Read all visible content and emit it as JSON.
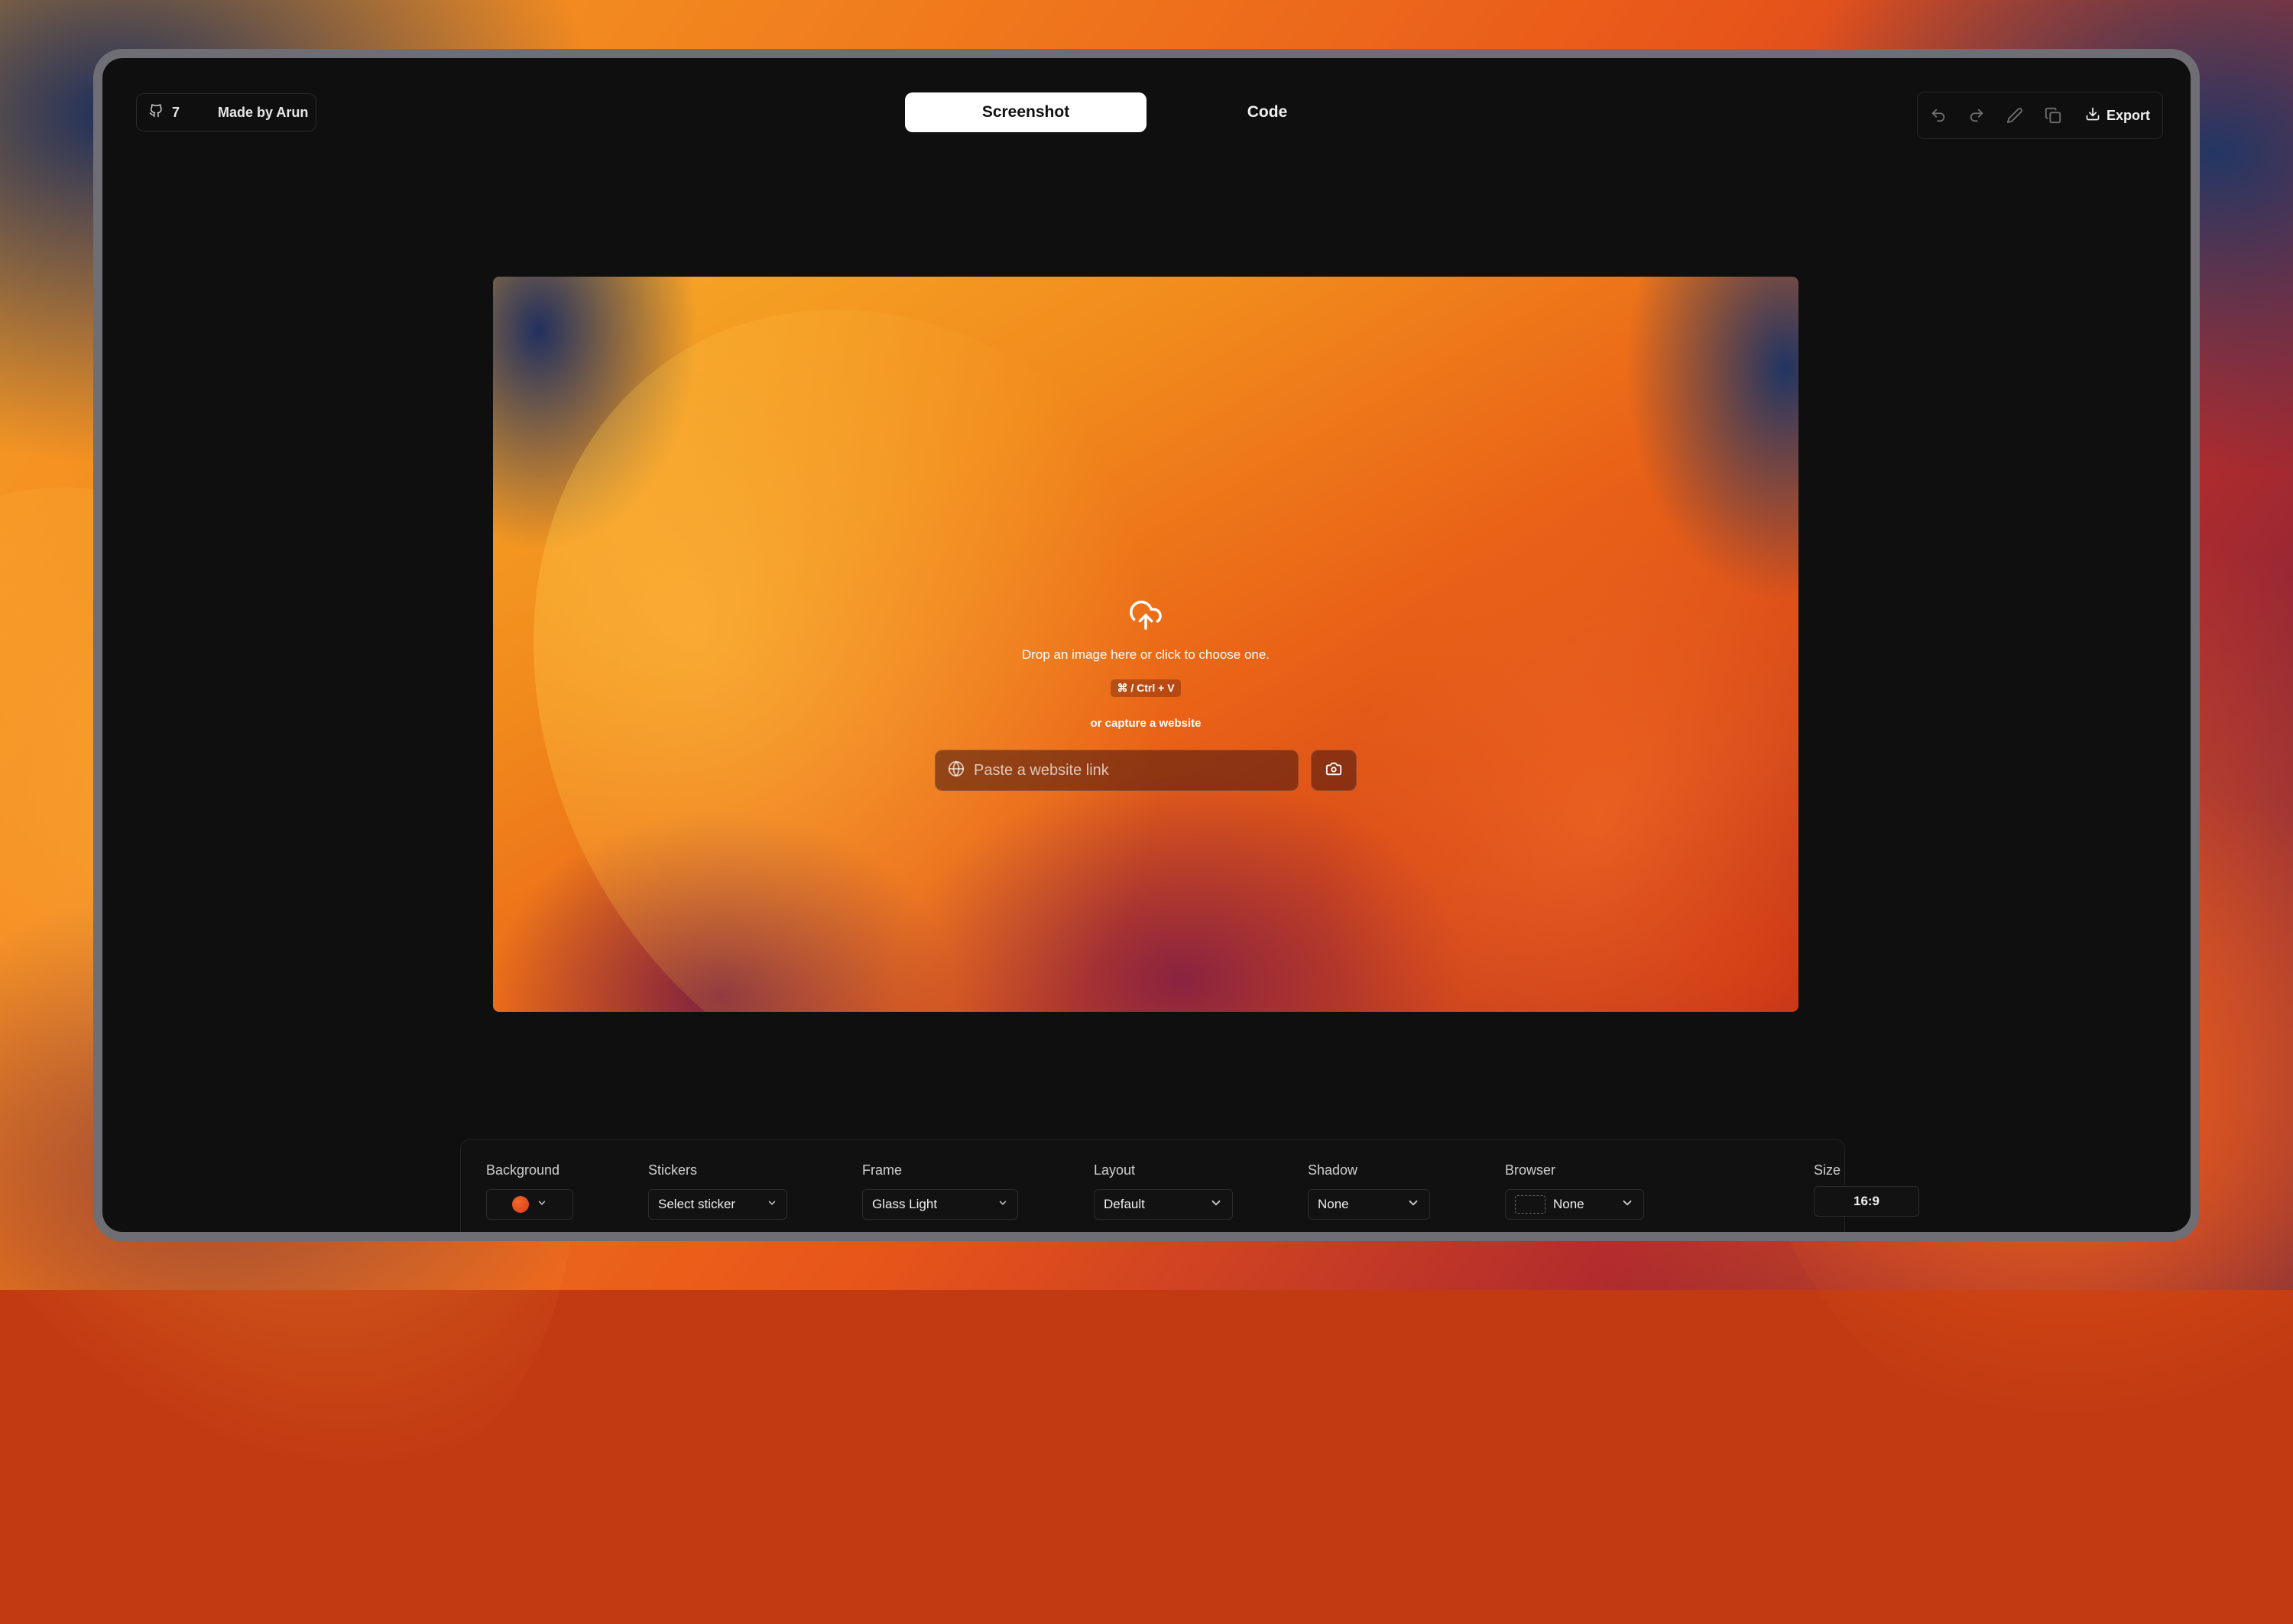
{
  "badge": {
    "stars": "7",
    "author": "Made by Arun"
  },
  "tabs": [
    {
      "label": "Screenshot",
      "active": true
    },
    {
      "label": "Code",
      "active": false
    }
  ],
  "toolbar": {
    "icons": [
      "undo-icon",
      "redo-icon",
      "pencil-icon",
      "copy-icon"
    ],
    "export_label": "Export"
  },
  "canvas": {
    "drop_message": "Drop an image here or click to choose one.",
    "shortcut": "⌘ / Ctrl + V",
    "capture_text": "or capture a website",
    "url_placeholder": "Paste a website link",
    "url_value": ""
  },
  "controls": {
    "background": {
      "label": "Background",
      "swatch_color": "#d83a1a"
    },
    "stickers": {
      "label": "Stickers",
      "value": "Select sticker"
    },
    "frame": {
      "label": "Frame",
      "value": "Glass Light"
    },
    "layout": {
      "label": "Layout",
      "value": "Default"
    },
    "shadow": {
      "label": "Shadow",
      "value": "None"
    },
    "browser": {
      "label": "Browser",
      "value": "None"
    },
    "size": {
      "label": "Size",
      "value": "16:9"
    }
  }
}
